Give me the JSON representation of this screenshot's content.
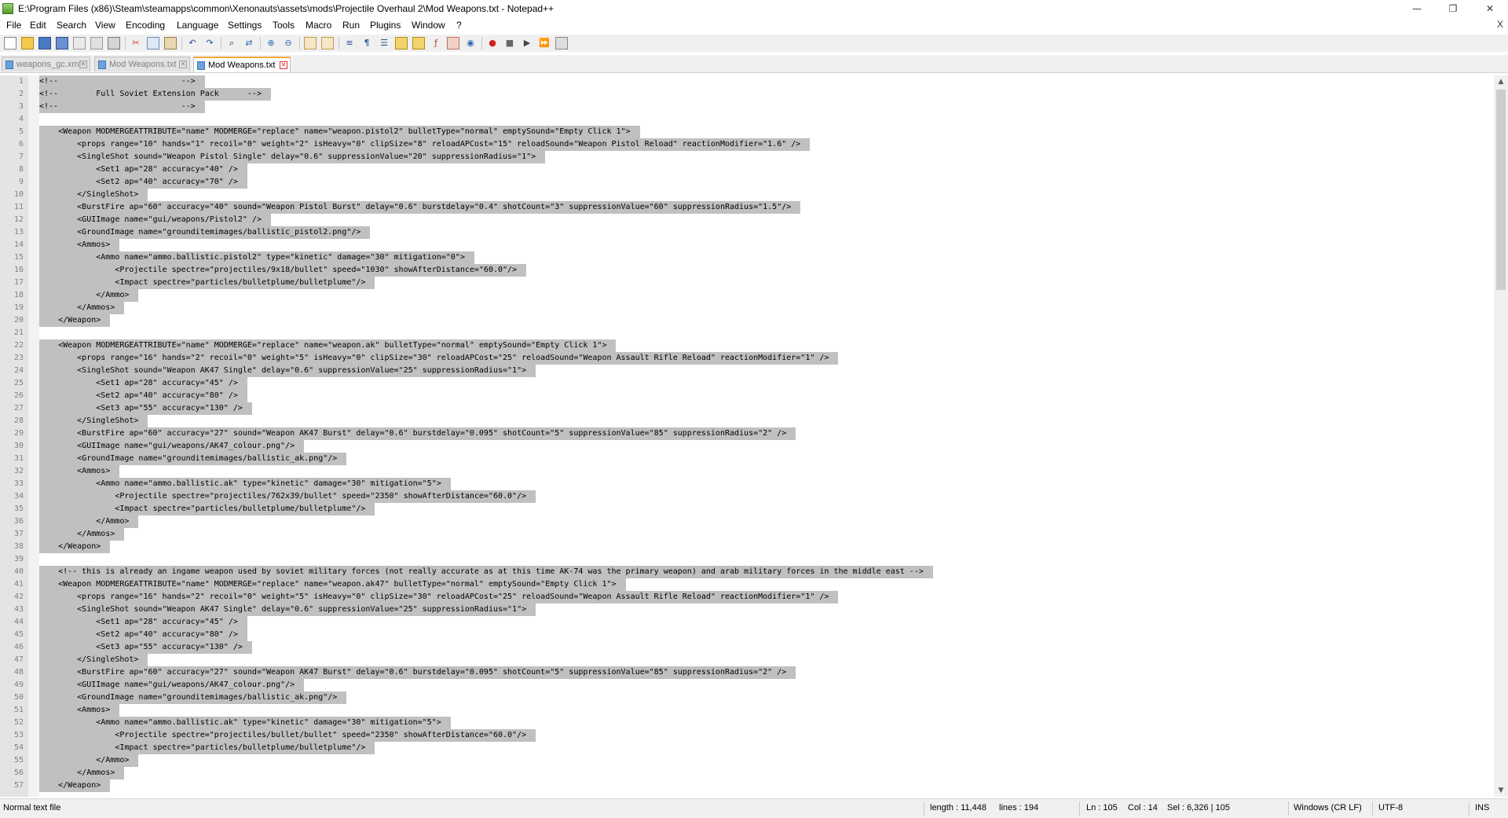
{
  "window": {
    "title": "E:\\Program Files (x86)\\Steam\\steamapps\\common\\Xenonauts\\assets\\mods\\Projectile Overhaul 2\\Mod Weapons.txt - Notepad++",
    "minimize": "—",
    "maximize": "❐",
    "close": "✕"
  },
  "menu": {
    "items": [
      "File",
      "Edit",
      "Search",
      "View",
      "Encoding",
      "Language",
      "Settings",
      "Tools",
      "Macro",
      "Run",
      "Plugins",
      "Window",
      "?"
    ],
    "close_doc": "X"
  },
  "tabs": [
    {
      "label": "weapons_gc.xml",
      "active": false
    },
    {
      "label": "Mod Weapons.txt",
      "active": false
    },
    {
      "label": "Mod Weapons.txt",
      "active": true
    }
  ],
  "editor": {
    "lines": [
      {
        "n": "1",
        "text": "<!--                          -->"
      },
      {
        "n": "2",
        "text": "<!--        Full Soviet Extension Pack      -->"
      },
      {
        "n": "3",
        "text": "<!--                          -->"
      },
      {
        "n": "4",
        "text": ""
      },
      {
        "n": "5",
        "text": "    <Weapon MODMERGEATTRIBUTE=\"name\" MODMERGE=\"replace\" name=\"weapon.pistol2\" bulletType=\"normal\" emptySound=\"Empty Click 1\">"
      },
      {
        "n": "6",
        "text": "        <props range=\"10\" hands=\"1\" recoil=\"0\" weight=\"2\" isHeavy=\"0\" clipSize=\"8\" reloadAPCost=\"15\" reloadSound=\"Weapon Pistol Reload\" reactionModifier=\"1.6\" />"
      },
      {
        "n": "7",
        "text": "        <SingleShot sound=\"Weapon Pistol Single\" delay=\"0.6\" suppressionValue=\"20\" suppressionRadius=\"1\">"
      },
      {
        "n": "8",
        "text": "            <Set1 ap=\"28\" accuracy=\"40\" />"
      },
      {
        "n": "9",
        "text": "            <Set2 ap=\"40\" accuracy=\"70\" />"
      },
      {
        "n": "10",
        "text": "        </SingleShot>"
      },
      {
        "n": "11",
        "text": "        <BurstFire ap=\"60\" accuracy=\"40\" sound=\"Weapon Pistol Burst\" delay=\"0.6\" burstdelay=\"0.4\" shotCount=\"3\" suppressionValue=\"60\" suppressionRadius=\"1.5\"/>"
      },
      {
        "n": "12",
        "text": "        <GUIImage name=\"gui/weapons/Pistol2\" />"
      },
      {
        "n": "13",
        "text": "        <GroundImage name=\"grounditemimages/ballistic_pistol2.png\"/>"
      },
      {
        "n": "14",
        "text": "        <Ammos>"
      },
      {
        "n": "15",
        "text": "            <Ammo name=\"ammo.ballistic.pistol2\" type=\"kinetic\" damage=\"30\" mitigation=\"0\">"
      },
      {
        "n": "16",
        "text": "                <Projectile spectre=\"projectiles/9x18/bullet\" speed=\"1030\" showAfterDistance=\"60.0\"/>"
      },
      {
        "n": "17",
        "text": "                <Impact spectre=\"particles/bulletplume/bulletplume\"/>"
      },
      {
        "n": "18",
        "text": "            </Ammo>"
      },
      {
        "n": "19",
        "text": "        </Ammos>"
      },
      {
        "n": "20",
        "text": "    </Weapon>"
      },
      {
        "n": "21",
        "text": ""
      },
      {
        "n": "22",
        "text": "    <Weapon MODMERGEATTRIBUTE=\"name\" MODMERGE=\"replace\" name=\"weapon.ak\" bulletType=\"normal\" emptySound=\"Empty Click 1\">"
      },
      {
        "n": "23",
        "text": "        <props range=\"16\" hands=\"2\" recoil=\"0\" weight=\"5\" isHeavy=\"0\" clipSize=\"30\" reloadAPCost=\"25\" reloadSound=\"Weapon Assault Rifle Reload\" reactionModifier=\"1\" />"
      },
      {
        "n": "24",
        "text": "        <SingleShot sound=\"Weapon AK47 Single\" delay=\"0.6\" suppressionValue=\"25\" suppressionRadius=\"1\">"
      },
      {
        "n": "25",
        "text": "            <Set1 ap=\"28\" accuracy=\"45\" />"
      },
      {
        "n": "26",
        "text": "            <Set2 ap=\"40\" accuracy=\"80\" />"
      },
      {
        "n": "27",
        "text": "            <Set3 ap=\"55\" accuracy=\"130\" />"
      },
      {
        "n": "28",
        "text": "        </SingleShot>"
      },
      {
        "n": "29",
        "text": "        <BurstFire ap=\"60\" accuracy=\"27\" sound=\"Weapon AK47 Burst\" delay=\"0.6\" burstdelay=\"0.095\" shotCount=\"5\" suppressionValue=\"85\" suppressionRadius=\"2\" />"
      },
      {
        "n": "30",
        "text": "        <GUIImage name=\"gui/weapons/AK47_colour.png\"/>"
      },
      {
        "n": "31",
        "text": "        <GroundImage name=\"grounditemimages/ballistic_ak.png\"/>"
      },
      {
        "n": "32",
        "text": "        <Ammos>"
      },
      {
        "n": "33",
        "text": "            <Ammo name=\"ammo.ballistic.ak\" type=\"kinetic\" damage=\"30\" mitigation=\"5\">"
      },
      {
        "n": "34",
        "text": "                <Projectile spectre=\"projectiles/762x39/bullet\" speed=\"2350\" showAfterDistance=\"60.0\"/>"
      },
      {
        "n": "35",
        "text": "                <Impact spectre=\"particles/bulletplume/bulletplume\"/>"
      },
      {
        "n": "36",
        "text": "            </Ammo>"
      },
      {
        "n": "37",
        "text": "        </Ammos>"
      },
      {
        "n": "38",
        "text": "    </Weapon>"
      },
      {
        "n": "39",
        "text": ""
      },
      {
        "n": "40",
        "text": "    <!-- this is already an ingame weapon used by soviet military forces (not really accurate as at this time AK-74 was the primary weapon) and arab military forces in the middle east -->"
      },
      {
        "n": "41",
        "text": "    <Weapon MODMERGEATTRIBUTE=\"name\" MODMERGE=\"replace\" name=\"weapon.ak47\" bulletType=\"normal\" emptySound=\"Empty Click 1\">"
      },
      {
        "n": "42",
        "text": "        <props range=\"16\" hands=\"2\" recoil=\"0\" weight=\"5\" isHeavy=\"0\" clipSize=\"30\" reloadAPCost=\"25\" reloadSound=\"Weapon Assault Rifle Reload\" reactionModifier=\"1\" />"
      },
      {
        "n": "43",
        "text": "        <SingleShot sound=\"Weapon AK47 Single\" delay=\"0.6\" suppressionValue=\"25\" suppressionRadius=\"1\">"
      },
      {
        "n": "44",
        "text": "            <Set1 ap=\"28\" accuracy=\"45\" />"
      },
      {
        "n": "45",
        "text": "            <Set2 ap=\"40\" accuracy=\"80\" />"
      },
      {
        "n": "46",
        "text": "            <Set3 ap=\"55\" accuracy=\"130\" />"
      },
      {
        "n": "47",
        "text": "        </SingleShot>"
      },
      {
        "n": "48",
        "text": "        <BurstFire ap=\"60\" accuracy=\"27\" sound=\"Weapon AK47 Burst\" delay=\"0.6\" burstdelay=\"0.095\" shotCount=\"5\" suppressionValue=\"85\" suppressionRadius=\"2\" />"
      },
      {
        "n": "49",
        "text": "        <GUIImage name=\"gui/weapons/AK47_colour.png\"/>"
      },
      {
        "n": "50",
        "text": "        <GroundImage name=\"grounditemimages/ballistic_ak.png\"/>"
      },
      {
        "n": "51",
        "text": "        <Ammos>"
      },
      {
        "n": "52",
        "text": "            <Ammo name=\"ammo.ballistic.ak\" type=\"kinetic\" damage=\"30\" mitigation=\"5\">"
      },
      {
        "n": "53",
        "text": "                <Projectile spectre=\"projectiles/bullet/bullet\" speed=\"2350\" showAfterDistance=\"60.0\"/>"
      },
      {
        "n": "54",
        "text": "                <Impact spectre=\"particles/bulletplume/bulletplume\"/>"
      },
      {
        "n": "55",
        "text": "            </Ammo>"
      },
      {
        "n": "56",
        "text": "        </Ammos>"
      },
      {
        "n": "57",
        "text": "    </Weapon>"
      }
    ]
  },
  "status": {
    "file_type": "Normal text file",
    "length": "length : 11,448",
    "lines": "lines : 194",
    "ln": "Ln : 105",
    "col": "Col : 14",
    "sel": "Sel : 6,326 | 105",
    "eol": "Windows (CR LF)",
    "encoding": "UTF-8",
    "mode": "INS"
  },
  "colors": {
    "selection": "#c0c0c0",
    "gutter": "#e4e4e4",
    "active_tab_accent": "#f4a742"
  }
}
